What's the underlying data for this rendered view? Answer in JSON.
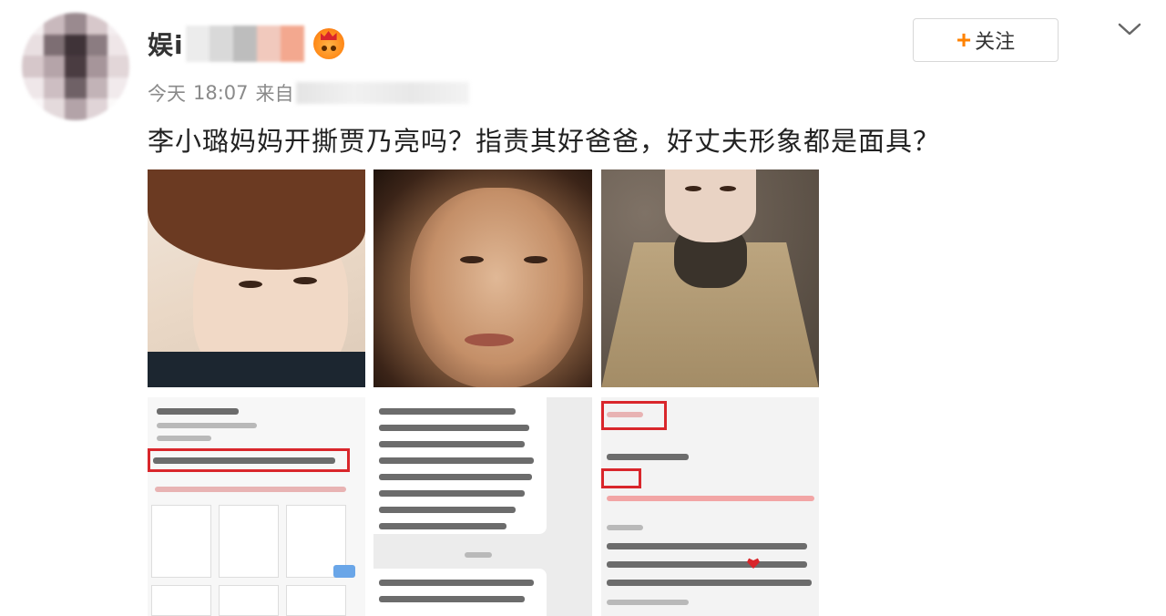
{
  "post": {
    "author_visible": "娱i",
    "time": "18:07",
    "date": "今天",
    "from_label": "来自",
    "text": "李小璐妈妈开撕贾乃亮吗？指责其好爸爸，好丈夫形象都是面具？",
    "follow_label": "关注",
    "follow_icon": "plus-icon",
    "menu_icon": "chevron-down-icon",
    "badge_icon": "vip-crown-badge-icon"
  },
  "colors": {
    "accent": "#ff8200",
    "highlight_red": "#d9262b",
    "meta_gray": "#8a8a8a"
  },
  "images": [
    {
      "name": "photo-man-portrait"
    },
    {
      "name": "photo-woman-portrait"
    },
    {
      "name": "photo-woman-in-coat"
    },
    {
      "name": "screenshot-post-highlight"
    },
    {
      "name": "screenshot-chat-text"
    },
    {
      "name": "screenshot-comments"
    }
  ]
}
